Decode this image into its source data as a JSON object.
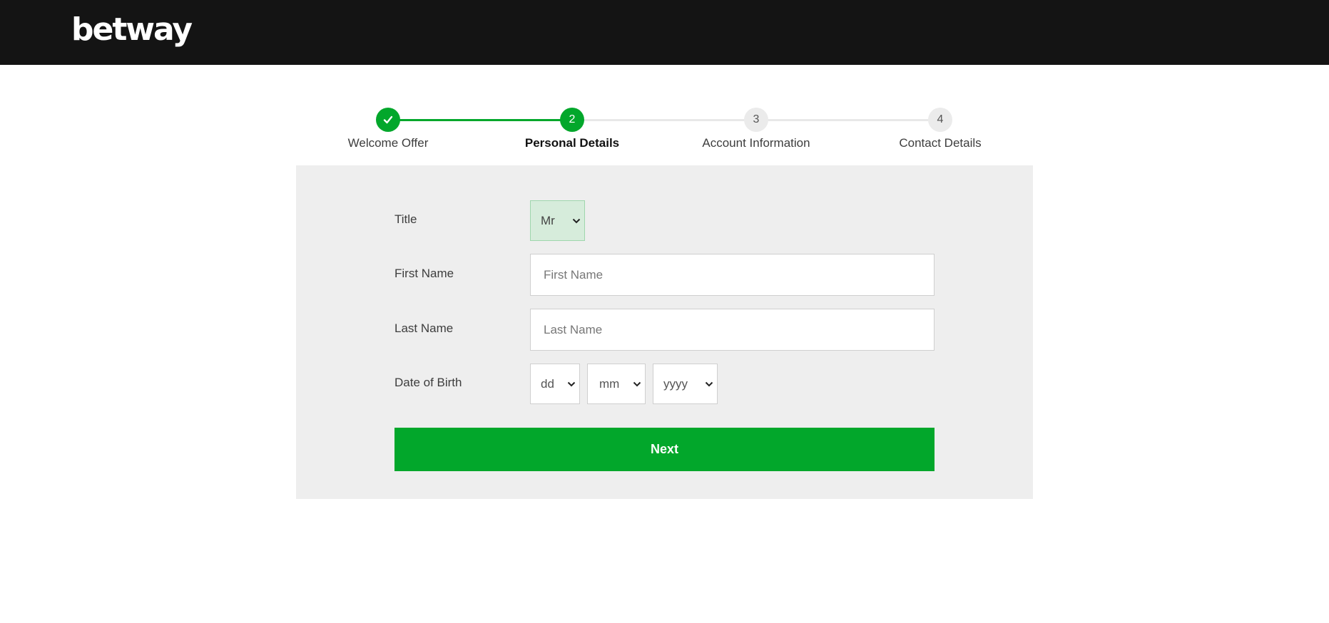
{
  "header": {
    "logo_text": "betway",
    "background_color": "#141414"
  },
  "stepper": {
    "accent_color": "#02a72b",
    "steps": [
      {
        "number": "",
        "label": "Welcome Offer",
        "state": "completed",
        "icon": "check-icon"
      },
      {
        "number": "2",
        "label": "Personal Details",
        "state": "active"
      },
      {
        "number": "3",
        "label": "Account Information",
        "state": "pending"
      },
      {
        "number": "4",
        "label": "Contact Details",
        "state": "pending"
      }
    ]
  },
  "form": {
    "title": {
      "label": "Title",
      "value": "Mr"
    },
    "first_name": {
      "label": "First Name",
      "placeholder": "First Name",
      "value": ""
    },
    "last_name": {
      "label": "Last Name",
      "placeholder": "Last Name",
      "value": ""
    },
    "dob": {
      "label": "Date of Birth",
      "day": "dd",
      "month": "mm",
      "year": "yyyy"
    },
    "next_label": "Next"
  }
}
